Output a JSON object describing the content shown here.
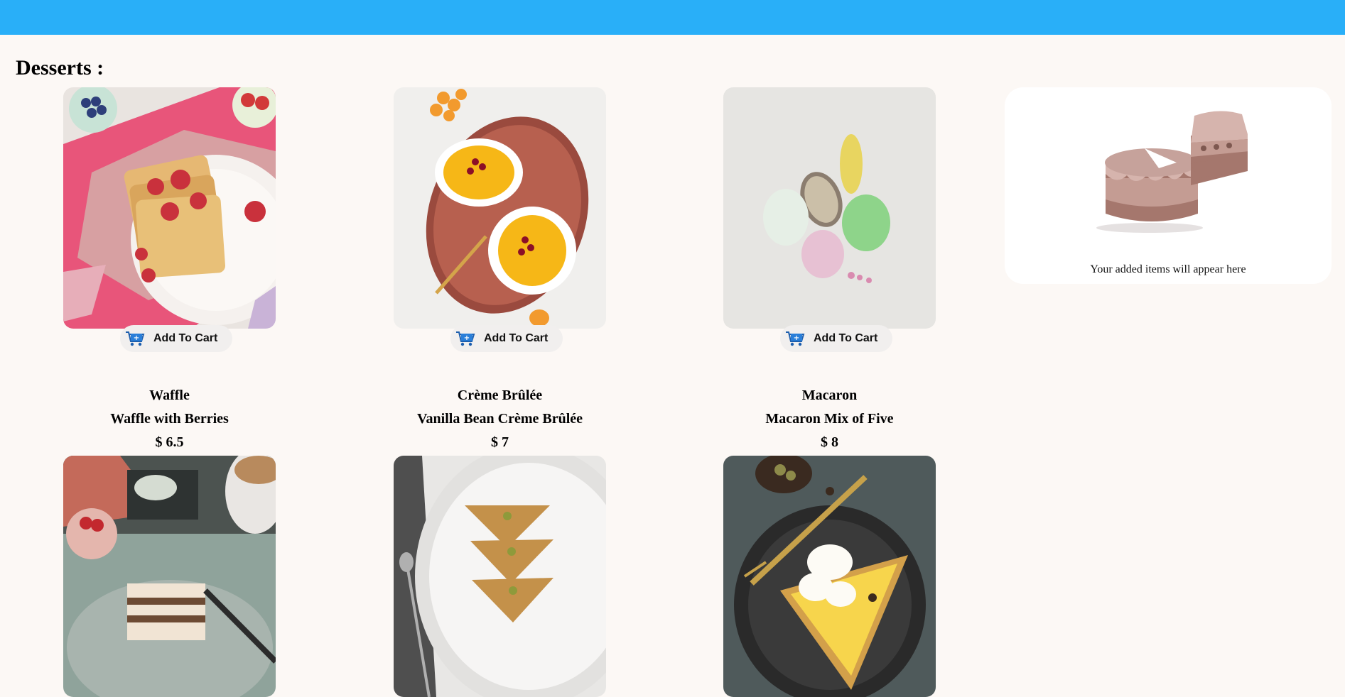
{
  "page": {
    "title": "Desserts :"
  },
  "cart": {
    "button_label": "Add To Cart",
    "empty_text": "Your added items will appear here"
  },
  "products": [
    {
      "category": "Waffle",
      "name": "Waffle with Berries",
      "price": "$ 6.5"
    },
    {
      "category": "Crème Brûlée",
      "name": "Vanilla Bean Crème Brûlée",
      "price": "$ 7"
    },
    {
      "category": "Macaron",
      "name": "Macaron Mix of Five",
      "price": "$ 8"
    },
    {
      "category": "",
      "name": "",
      "price": ""
    },
    {
      "category": "",
      "name": "",
      "price": ""
    },
    {
      "category": "",
      "name": "",
      "price": ""
    }
  ],
  "colors": {
    "header": "#29aff8",
    "background": "#fcf8f5",
    "button_bg": "#f1efee",
    "cart_icon": "#2a7fd9"
  },
  "icons": {
    "cart": "cart-plus-icon",
    "empty_cart": "cake-illustration"
  }
}
